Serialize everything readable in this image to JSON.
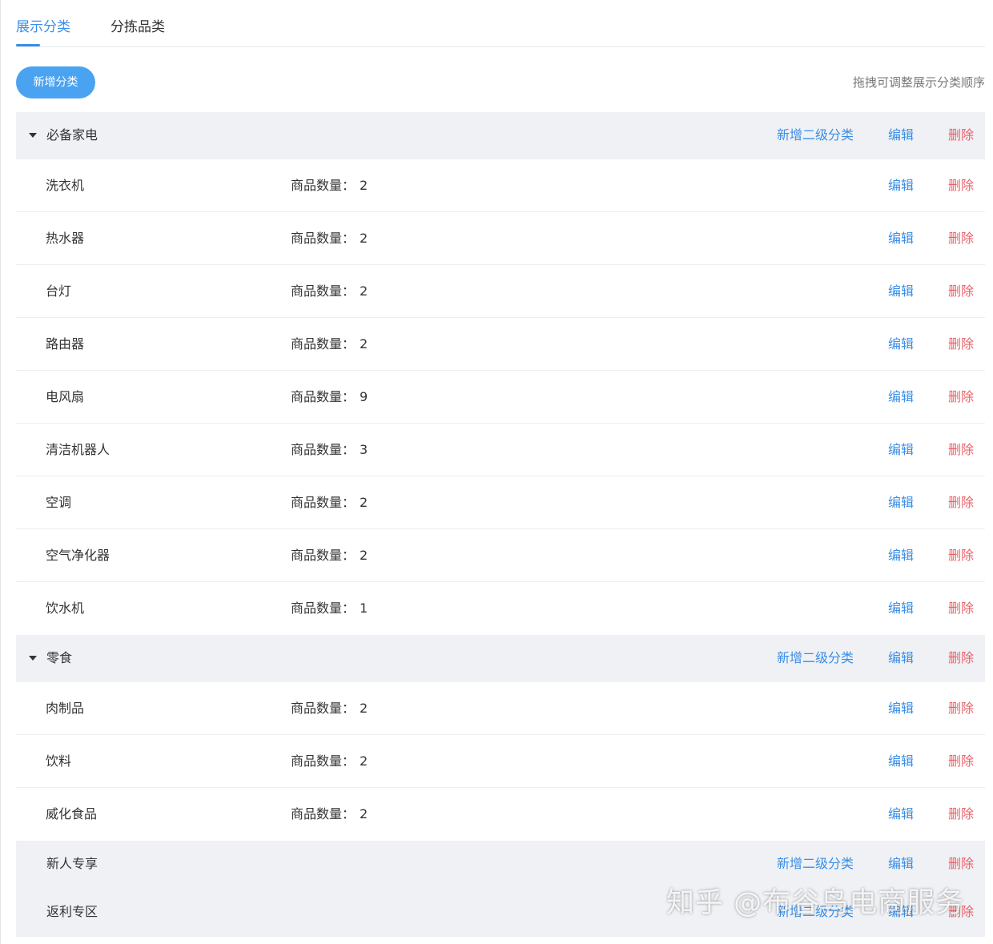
{
  "tabs": [
    {
      "label": "展示分类",
      "active": true
    },
    {
      "label": "分拣品类",
      "active": false
    }
  ],
  "toolbar": {
    "add_category_label": "新增分类",
    "hint": "拖拽可调整展示分类顺序"
  },
  "labels": {
    "count_label": "商品数量：",
    "add_sub_label": "新增二级分类",
    "edit_label": "编辑",
    "delete_label": "删除"
  },
  "groups": [
    {
      "name": "必备家电",
      "expanded": true,
      "items": [
        {
          "name": "洗衣机",
          "count": "2"
        },
        {
          "name": "热水器",
          "count": "2"
        },
        {
          "name": "台灯",
          "count": "2"
        },
        {
          "name": "路由器",
          "count": "2"
        },
        {
          "name": "电风扇",
          "count": "9"
        },
        {
          "name": "清洁机器人",
          "count": "3"
        },
        {
          "name": "空调",
          "count": "2"
        },
        {
          "name": "空气净化器",
          "count": "2"
        },
        {
          "name": "饮水机",
          "count": "1"
        }
      ]
    },
    {
      "name": "零食",
      "expanded": true,
      "items": [
        {
          "name": "肉制品",
          "count": "2"
        },
        {
          "name": "饮料",
          "count": "2"
        },
        {
          "name": "威化食品",
          "count": "2"
        }
      ]
    },
    {
      "name": "新人专享",
      "expanded": false,
      "items": []
    },
    {
      "name": "返利专区",
      "expanded": false,
      "items": []
    }
  ],
  "watermark": "知乎 @布谷鸟电商服务",
  "colors": {
    "accent": "#3a8ee6",
    "button": "#4aa3f0",
    "danger": "#e8636a",
    "group_bg": "#eff1f5"
  }
}
